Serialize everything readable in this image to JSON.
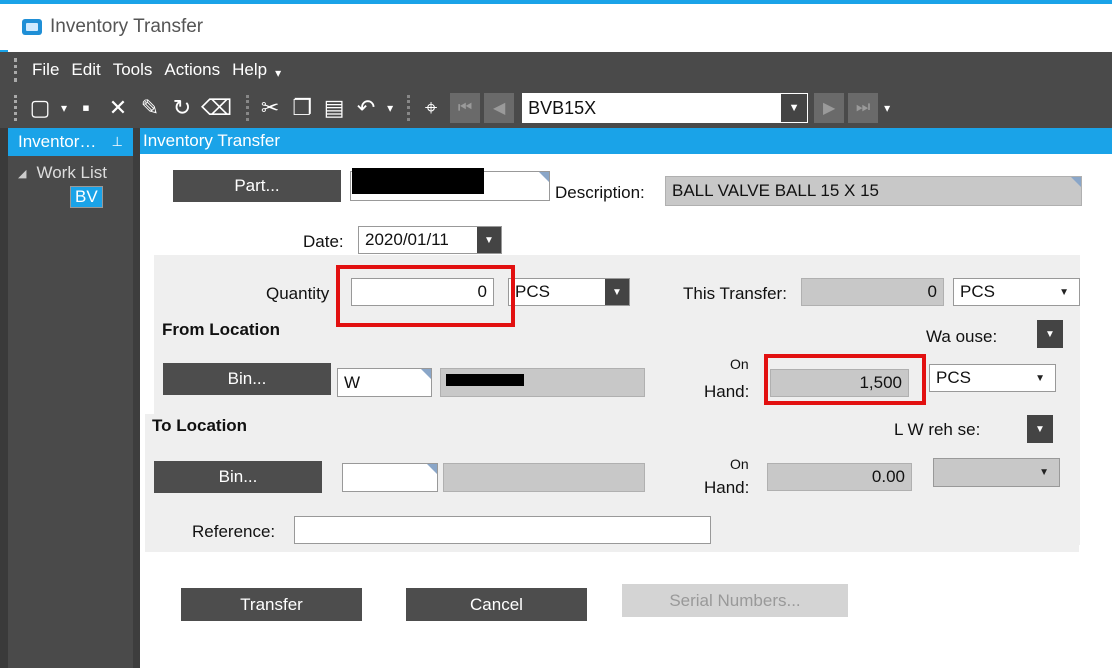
{
  "window": {
    "title": "Inventory Transfer"
  },
  "menu": {
    "items": [
      "File",
      "Edit",
      "Tools",
      "Actions",
      "Help"
    ]
  },
  "toolbar": {
    "key_value": "BVB15X"
  },
  "tree_pane": {
    "title": "Inventor…",
    "root_label": "Work List",
    "child_label": "BV"
  },
  "form": {
    "header": "Inventory Transfer",
    "part_button": "Part...",
    "description_label": "Description:",
    "description_value": "BALL VALVE BALL 15 X 15",
    "date_label": "Date:",
    "date_value": "2020/01/11",
    "quantity_label": "Quantity",
    "quantity_value": "0",
    "quantity_uom": "PCS",
    "this_transfer_label": "This Transfer:",
    "this_transfer_value": "0",
    "this_transfer_uom": "PCS",
    "from": {
      "title": "From Location",
      "warehouse_label": "Wa   ouse:",
      "bin_button": "Bin...",
      "bin_value": "W",
      "on_hand_label_top": "On",
      "on_hand_label": "Hand:",
      "on_hand_value": "1,500",
      "on_hand_uom": "PCS"
    },
    "to": {
      "title": "To Location",
      "warehouse_label": "L W  reh  se:",
      "bin_button": "Bin...",
      "on_hand_label_top": "On",
      "on_hand_label": "Hand:",
      "on_hand_value": "0.00",
      "reference_label": "Reference:"
    },
    "buttons": {
      "transfer": "Transfer",
      "cancel": "Cancel",
      "serial": "Serial Numbers..."
    }
  },
  "colors": {
    "accent": "#1aa3e8",
    "dark": "#4a4a4a",
    "highlight": "#e21010"
  }
}
